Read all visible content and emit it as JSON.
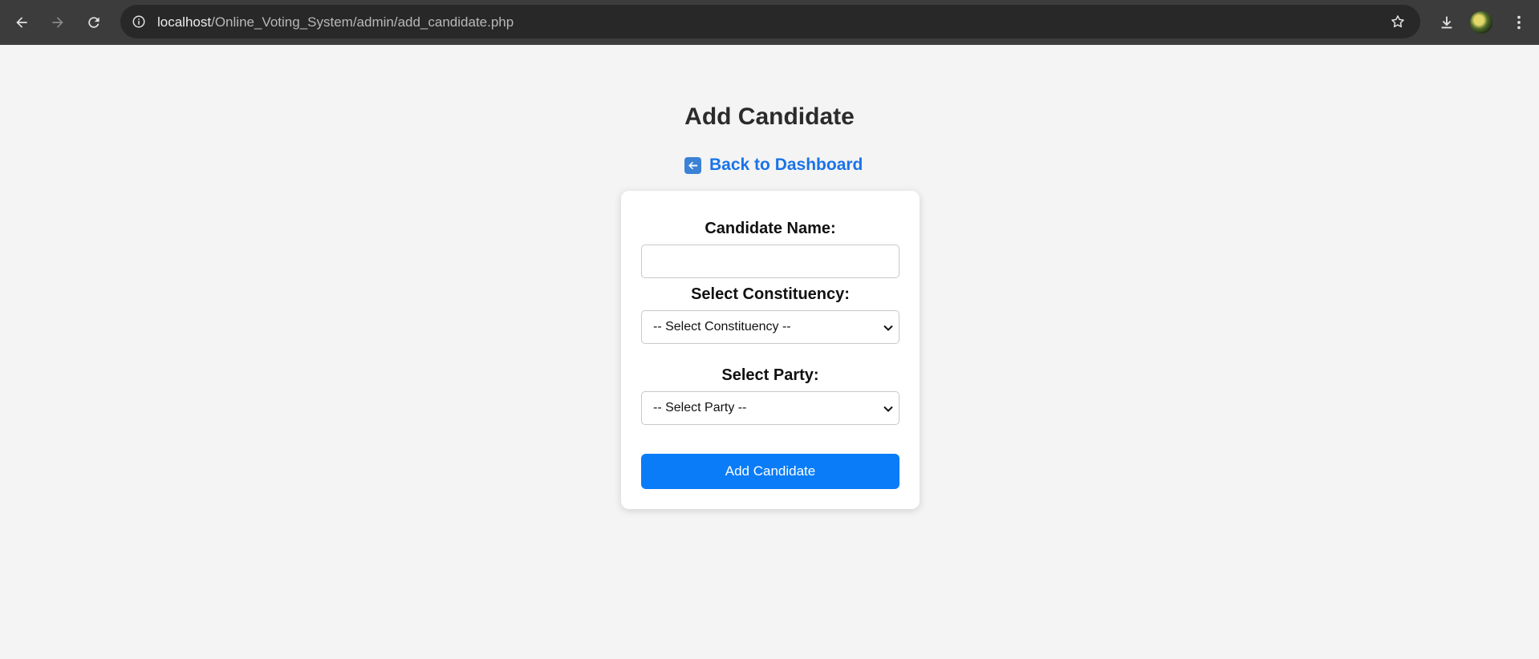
{
  "browser": {
    "url_host": "localhost",
    "url_path": "/Online_Voting_System/admin/add_candidate.php"
  },
  "page": {
    "title": "Add Candidate",
    "back_link": "Back to Dashboard"
  },
  "form": {
    "name_label": "Candidate Name:",
    "name_value": "",
    "constituency_label": "Select Constituency:",
    "constituency_selected": "-- Select Constituency --",
    "party_label": "Select Party:",
    "party_selected": "-- Select Party --",
    "submit_label": "Add Candidate"
  },
  "colors": {
    "accent": "#0a7cf8",
    "link": "#1a73e8",
    "background": "#f4f4f4"
  }
}
